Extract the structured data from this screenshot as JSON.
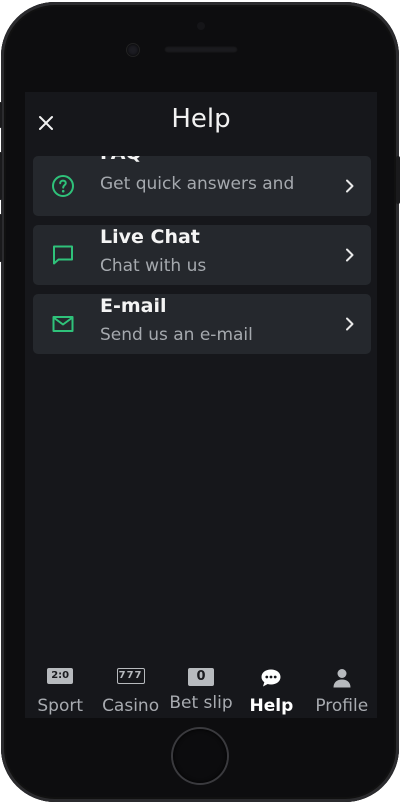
{
  "header": {
    "title": "Help"
  },
  "help_items": [
    {
      "title": "FAQ",
      "subtitle": "Get quick answers and",
      "icon": "question-circle-icon"
    },
    {
      "title": "Live Chat",
      "subtitle": "Chat with us",
      "icon": "chat-bubble-icon"
    },
    {
      "title": "E-mail",
      "subtitle": "Send us an e-mail",
      "icon": "envelope-icon"
    }
  ],
  "tabbar": {
    "sport": {
      "label": "Sport",
      "icon_text": "2:0"
    },
    "casino": {
      "label": "Casino",
      "icon_text": "777"
    },
    "betslip": {
      "label": "Bet slip",
      "icon_text": "0"
    },
    "help": {
      "label": "Help"
    },
    "profile": {
      "label": "Profile"
    },
    "active": "help"
  },
  "colors": {
    "accent_green": "#2fc27a",
    "background": "#16171b",
    "card": "#25282d",
    "muted_text": "#a5a9ae"
  }
}
